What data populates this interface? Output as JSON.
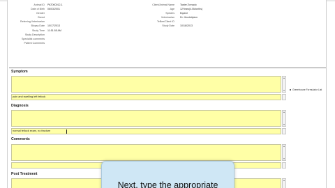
{
  "patient_info": {
    "left": [
      {
        "label": "Animal ID",
        "value": "PAT000012-1"
      },
      {
        "label": "Date of Birth",
        "value": "06/03/2001"
      },
      {
        "label": "Gender",
        "value": ""
      },
      {
        "label": "Breed",
        "value": ""
      },
      {
        "label": "Referring Veterinarian",
        "value": ""
      },
      {
        "label": "Biopsy Date",
        "value": "10/17/2013"
      },
      {
        "label": "Study Time",
        "value": "11:51:55 AM"
      },
      {
        "label": "Study Description",
        "value": ""
      },
      {
        "label": "Specialist comments",
        "value": ""
      },
      {
        "label": "Patient Comments",
        "value": ""
      }
    ],
    "right": [
      {
        "label": "Client/Animal Name",
        "value": "Taster,Tornado"
      },
      {
        "label": "Age",
        "value": "12Years(4.5Months)"
      },
      {
        "label": "Species",
        "value": "Equine"
      },
      {
        "label": "Veterinarian",
        "value": "Dr. Hewlettpicm"
      },
      {
        "label": "TeBee/Client ID",
        "value": ""
      },
      {
        "label": "Study Date",
        "value": "10/18/2013"
      }
    ]
  },
  "sections": {
    "symptom": {
      "title": "Symptom",
      "value": "pain and swelling left fetlock"
    },
    "diagnosis": {
      "title": "Diagnosis",
      "value": "normal fetlock exam, no fracture"
    },
    "comments": {
      "title": "Comments",
      "value": ""
    },
    "post_treatment": {
      "title": "Post Treatment",
      "value": ""
    }
  },
  "side_link": "Greenhouse Formulator List",
  "tooltip": {
    "text": "Next, type the appropriate"
  },
  "colors": {
    "field_bg": "#ffffa6",
    "tooltip_bg": "#cfe7f5"
  }
}
